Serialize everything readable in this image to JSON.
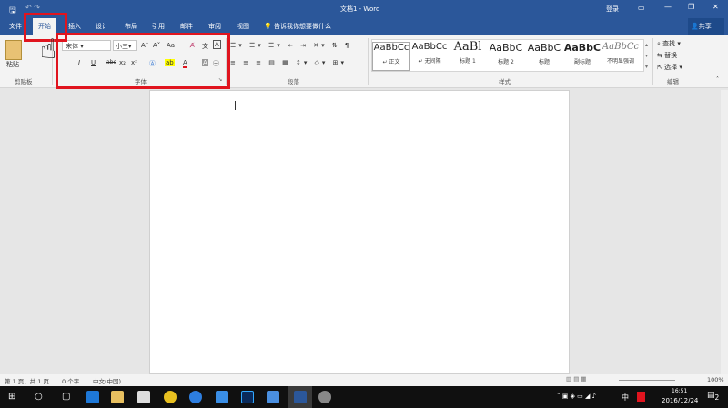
{
  "title": "文档1 - Word",
  "login": "登录",
  "share": "共享",
  "tabs": [
    {
      "label": "文件"
    },
    {
      "label": "开始"
    },
    {
      "label": "插入"
    },
    {
      "label": "设计"
    },
    {
      "label": "布局"
    },
    {
      "label": "引用"
    },
    {
      "label": "邮件"
    },
    {
      "label": "审阅"
    },
    {
      "label": "视图"
    }
  ],
  "tell_me": "告诉我你想要做什么",
  "clipboard": {
    "paste": "粘贴",
    "label": "剪贴板"
  },
  "font": {
    "name": "宋体",
    "size": "小三",
    "label": "字体",
    "bold": "B",
    "italic": "I",
    "underline": "U",
    "strike": "abc",
    "sub": "x₂",
    "sup": "x²",
    "grow": "A˄",
    "shrink": "A˅",
    "case": "Aa"
  },
  "paragraph": {
    "label": "段落"
  },
  "styles": {
    "label": "样式",
    "items": [
      {
        "sample": "AaBbCc",
        "name": "↵ 正文"
      },
      {
        "sample": "AaBbCc",
        "name": "↵ 无间隔"
      },
      {
        "sample": "AaBl",
        "name": "标题 1"
      },
      {
        "sample": "AaBbC",
        "name": "标题 2"
      },
      {
        "sample": "AaBbC",
        "name": "标题"
      },
      {
        "sample": "AaBbC",
        "name": "副标题"
      },
      {
        "sample": "AaBbCc",
        "name": "不明显强调"
      }
    ]
  },
  "editing": {
    "label": "编辑",
    "find": "查找",
    "replace": "替换",
    "select": "选择"
  },
  "status": {
    "page": "第 1 页，共 1 页",
    "words": "0 个字",
    "lang": "中文(中国)",
    "zoom": "100%"
  },
  "taskbar": {
    "time": "16:51",
    "date": "2016/12/24",
    "ime": "中",
    "notif": "2"
  },
  "colors": {
    "brand": "#2b579a",
    "highlight": "#e0141e"
  }
}
